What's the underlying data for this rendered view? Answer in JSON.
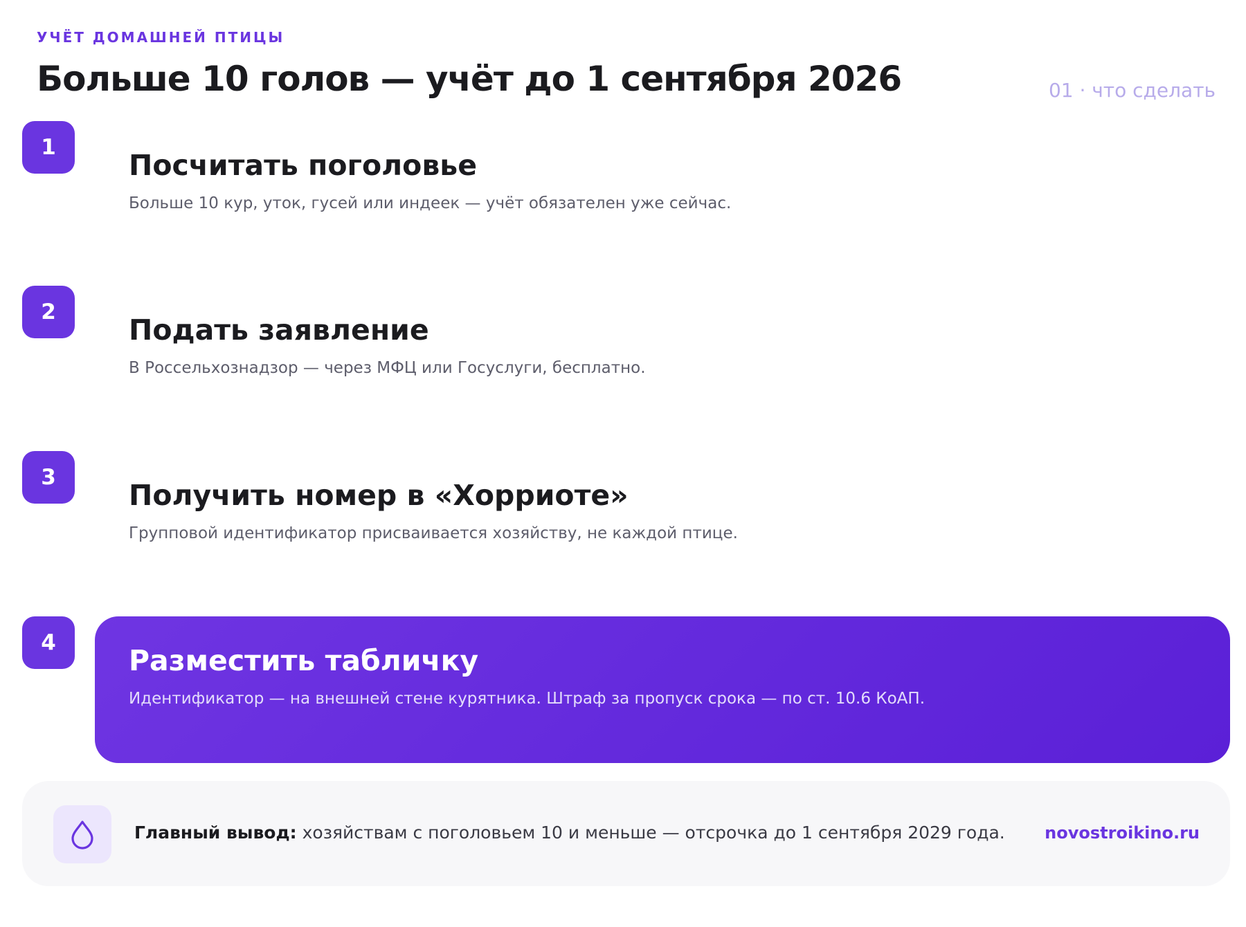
{
  "header": {
    "kicker": "УЧЁТ ДОМАШНЕЙ ПТИЦЫ",
    "title": "Больше 10 голов — учёт до 1 сентября 2026",
    "index": "01 · что сделать"
  },
  "steps": [
    {
      "number": "1",
      "title": "Посчитать поголовье",
      "desc": "Больше 10 кур, уток, гусей или индеек — учёт обязателен уже сейчас."
    },
    {
      "number": "2",
      "title": "Подать заявление",
      "desc": "В Россельхознадзор — через МФЦ или Госуслуги, бесплатно."
    },
    {
      "number": "3",
      "title": "Получить номер в «Хорриоте»",
      "desc": "Групповой идентификатор присваивается хозяйству, не каждой птице."
    },
    {
      "number": "4",
      "title": "Разместить табличку",
      "desc": "Идентификатор — на внешней стене курятника. Штраф за пропуск срока — по ст. 10.6 КоАП."
    }
  ],
  "footer": {
    "icon": "drop-icon",
    "lead": "Главный вывод:",
    "text": " хозяйствам с поголовьем 10 и меньше — отсрочка до 1 сентября 2029 года.",
    "site": "novostroikino.ru"
  },
  "colors": {
    "accent": "#6a35e0",
    "index_muted": "#b7abea",
    "footer_bg": "#f7f7f9"
  }
}
